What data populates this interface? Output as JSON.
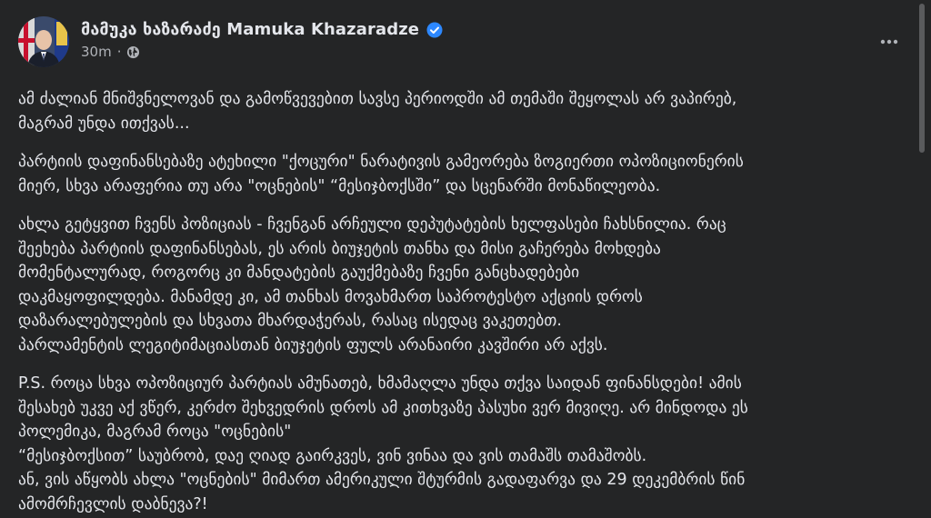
{
  "post": {
    "author": "მამუკა ხაზარაძე Mamuka Khazaradze",
    "verified": true,
    "timestamp": "30m",
    "separator": "·",
    "audience_icon": "globe-icon",
    "menu_icon": "more-horizontal-icon",
    "paragraphs": [
      "ამ ძალიან მნიშვნელოვან და გამოწვევებით სავსე პერიოდში ამ თემაში შეყოლას არ ვაპირებ,\nმაგრამ უნდა ითქვას...",
      "პარტიის დაფინანსებაზე ატეხილი \"ქოცური\" ნარატივის გამეორება ზოგიერთი ოპოზიციონერის\nმიერ, სხვა არაფერია თუ არა \"ოცნების\" “მესიჯბოქსში” და სცენარში მონაწილეობა.",
      "ახლა გეტყვით ჩვენს პოზიციას - ჩვენგან არჩეული  დეპუტატების ხელფასები ჩახსნილია. რაც\nშეეხება პარტიის დაფინანსებას, ეს არის ბიუჯეტის თანხა და მისი გაჩერება მოხდება\nმომენტალურად, როგორც კი მანდატების  გაუქმებაზე ჩვენი განცხადებები\nდაკმაყოფილდება. მანამდე კი, ამ თანხას მოვახმართ საპროტესტო აქციის დროს\nდაზარალებულების და სხვათა მხარდაჭერას, რასაც ისედაც ვაკეთებთ.\nპარლამენტის ლეგიტიმაციასთან ბიუჯეტის ფულს არანაირი კავშირი არ აქვს.",
      "P.S. როცა სხვა ოპოზიციურ პარტიას ამუნათებ, ხმამაღლა უნდა თქვა საიდან ფინანსდები! ამის\nშესახებ უკვე აქ ვწერ, კერძო შეხვედრის დროს ამ კითხვაზე პასუხი ვერ მივიღე. არ მინდოდა ეს\nპოლემიკა, მაგრამ როცა \"ოცნების\"\n“მესიჯბოქსით” საუბრობ, დაე ღიად გაირკვეს, ვინ ვინაა და ვის თამაშს თამაშობს.\nან, ვის აწყობს ახლა \"ოცნების\" მიმართ ამერიკული შტურმის გადაფარვა და 29 დეკემბრის წინ\nამომრჩევლის დაბნევა?!"
    ]
  },
  "colors": {
    "background": "#242526",
    "primary_text": "#e4e6eb",
    "secondary_text": "#b0b3b8",
    "verified_badge": "#2d88ff"
  }
}
